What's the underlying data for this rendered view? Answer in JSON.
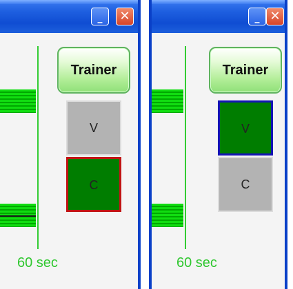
{
  "colors": {
    "titlebar": "#1e5fe0",
    "track_green": "#11dd11",
    "active_key": "#007d00",
    "inactive_key": "#b3b3b3",
    "left_active_border": "#c11414",
    "right_active_border": "#1414b4",
    "time_label": "#2fc72f"
  },
  "windows": [
    {
      "titlebar": {
        "minimize_glyph": "_",
        "close_glyph": "✕"
      },
      "trainer_button_label": "Trainer",
      "keys": [
        {
          "label": "V",
          "state": "inactive"
        },
        {
          "label": "C",
          "state": "active"
        }
      ],
      "time_label": "60 sec"
    },
    {
      "titlebar": {
        "minimize_glyph": "_",
        "close_glyph": "✕"
      },
      "trainer_button_label": "Trainer",
      "keys": [
        {
          "label": "V",
          "state": "active"
        },
        {
          "label": "C",
          "state": "inactive"
        }
      ],
      "time_label": "60 sec"
    }
  ]
}
